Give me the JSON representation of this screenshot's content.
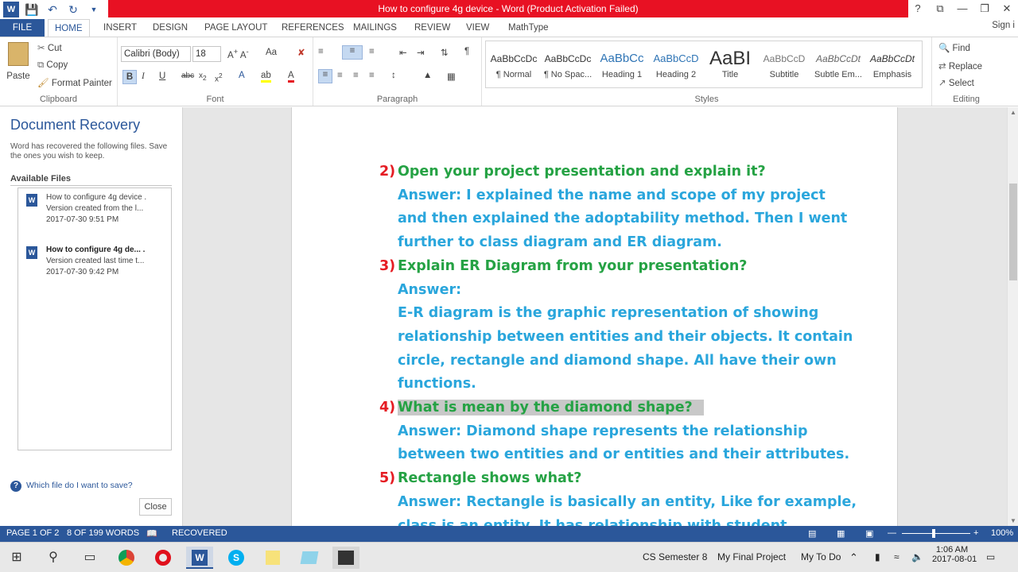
{
  "window": {
    "title": "How to configure 4g device - Word (Product Activation Failed)",
    "controls": [
      "?",
      "⧉",
      "—",
      "❐",
      "✕"
    ]
  },
  "tabs": [
    "FILE",
    "HOME",
    "INSERT",
    "DESIGN",
    "PAGE LAYOUT",
    "REFERENCES",
    "MAILINGS",
    "REVIEW",
    "VIEW",
    "MathType"
  ],
  "signin": "Sign i",
  "ribbon": {
    "clipboard": {
      "label": "Clipboard",
      "paste": "Paste",
      "cut": "Cut",
      "copy": "Copy",
      "format_painter": "Format Painter"
    },
    "font": {
      "label": "Font",
      "family": "Calibri (Body)",
      "size": "18",
      "aa": "Aa"
    },
    "paragraph": {
      "label": "Paragraph"
    },
    "styles": {
      "label": "Styles",
      "items": [
        {
          "sample": "AaBbCcDc",
          "name": "¶ Normal"
        },
        {
          "sample": "AaBbCcDc",
          "name": "¶ No Spac..."
        },
        {
          "sample": "AaBbCc",
          "name": "Heading 1"
        },
        {
          "sample": "AaBbCcD",
          "name": "Heading 2"
        },
        {
          "sample": "AaBI",
          "name": "Title"
        },
        {
          "sample": "AaBbCcD",
          "name": "Subtitle"
        },
        {
          "sample": "AaBbCcDt",
          "name": "Subtle Em..."
        },
        {
          "sample": "AaBbCcDt",
          "name": "Emphasis"
        }
      ]
    },
    "editing": {
      "label": "Editing",
      "find": "Find",
      "replace": "Replace",
      "select": "Select"
    }
  },
  "recovery": {
    "title": "Document Recovery",
    "desc": "Word has recovered the following files. Save the ones you wish to keep.",
    "available": "Available Files",
    "files": [
      {
        "name": "How to configure 4g device .",
        "version": "Version created from the l...",
        "time": "2017-07-30 9:51 PM"
      },
      {
        "name": "How to configure 4g de... .",
        "version": "Version created last time t...",
        "time": "2017-07-30 9:42 PM"
      }
    ],
    "help": "Which file do I want to save?",
    "close": "Close"
  },
  "document": {
    "lines": [
      {
        "num": "2)",
        "text": "Open your project presentation and explain it?",
        "cls": "q"
      },
      {
        "text": "Answer: I explained the name and scope of my project",
        "cls": "a"
      },
      {
        "text": "and then explained the adoptability method. Then I went",
        "cls": "a"
      },
      {
        "text": "further to class diagram and ER diagram.",
        "cls": "a"
      },
      {
        "num": "3)",
        "text": "Explain ER Diagram from your presentation?",
        "cls": "q"
      },
      {
        "text": "Answer:",
        "cls": "a"
      },
      {
        "text": "E-R diagram is the graphic representation of showing",
        "cls": "a"
      },
      {
        "text": "relationship between entities and their objects. It contain",
        "cls": "a"
      },
      {
        "text": "circle, rectangle and diamond shape. All have their own",
        "cls": "a"
      },
      {
        "text": "functions.",
        "cls": "a"
      },
      {
        "num": "4)",
        "text": "What is mean by the diamond shape?",
        "cls": "q hl"
      },
      {
        "text": "Answer: Diamond shape represents the relationship",
        "cls": "a"
      },
      {
        "text": "between two entities and or entities and their attributes.",
        "cls": "a"
      },
      {
        "num": "5)",
        "text": "Rectangle shows what?",
        "cls": "q"
      },
      {
        "text": "Answer: Rectangle is basically an entity, Like for example,",
        "cls": "a"
      },
      {
        "text": "class is an entity. It has relationship with student",
        "cls": "a"
      }
    ]
  },
  "status": {
    "page": "PAGE 1 OF 2",
    "words": "8 OF 199 WORDS",
    "recovered": "RECOVERED",
    "zoom": "100%"
  },
  "taskbar": {
    "items": [
      "CS Semester 8",
      "My Final Project",
      "My To Do"
    ],
    "time": "1:06 AM",
    "date": "2017-08-01"
  }
}
